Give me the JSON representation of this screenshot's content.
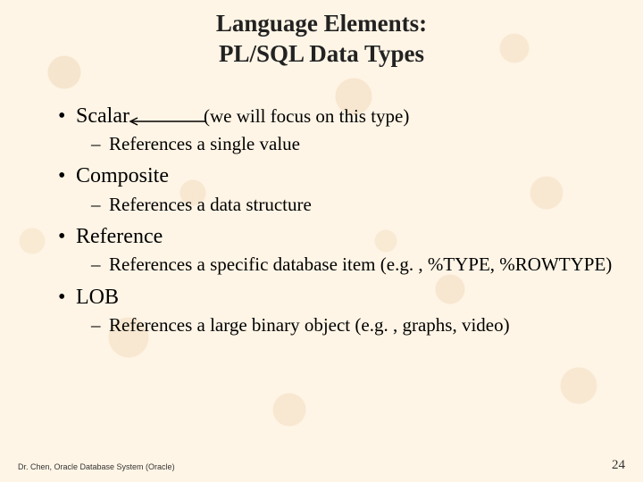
{
  "title_line1": "Language Elements:",
  "title_line2": "PL/SQL Data Types",
  "annotation": "(we will focus on this type)",
  "items": {
    "scalar": {
      "label": "Scalar",
      "sub": "References a single value"
    },
    "composite": {
      "label": "Composite",
      "sub": "References a data structure"
    },
    "reference": {
      "label": "Reference",
      "sub": "References a specific database item (e.g. , %TYPE, %ROWTYPE)"
    },
    "lob": {
      "label": "LOB",
      "sub": "References a large binary object (e.g. , graphs, video)"
    }
  },
  "footer_left": "Dr. Chen, Oracle Database System (Oracle)",
  "footer_right": "24"
}
